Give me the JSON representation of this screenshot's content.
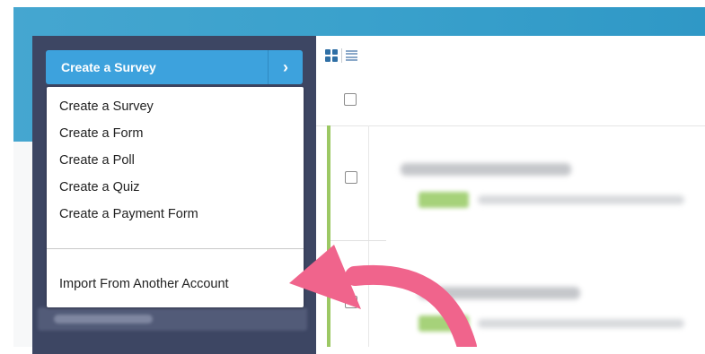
{
  "create_button": {
    "label": "Create a Survey",
    "chevron": "›"
  },
  "dropdown": {
    "items": [
      "Create a Survey",
      "Create a Form",
      "Create a Poll",
      "Create a Quiz",
      "Create a Payment Form"
    ],
    "import_label": "Import From Another Account"
  },
  "view_toggle": {
    "icons": [
      "grid-view-icon",
      "list-view-icon"
    ]
  },
  "colors": {
    "header_band": "#3aa1cc",
    "sidebar": "#3d4663",
    "create_button": "#3da2dd",
    "row_accent": "#9cc864",
    "annotation_arrow": "#f0648c"
  }
}
